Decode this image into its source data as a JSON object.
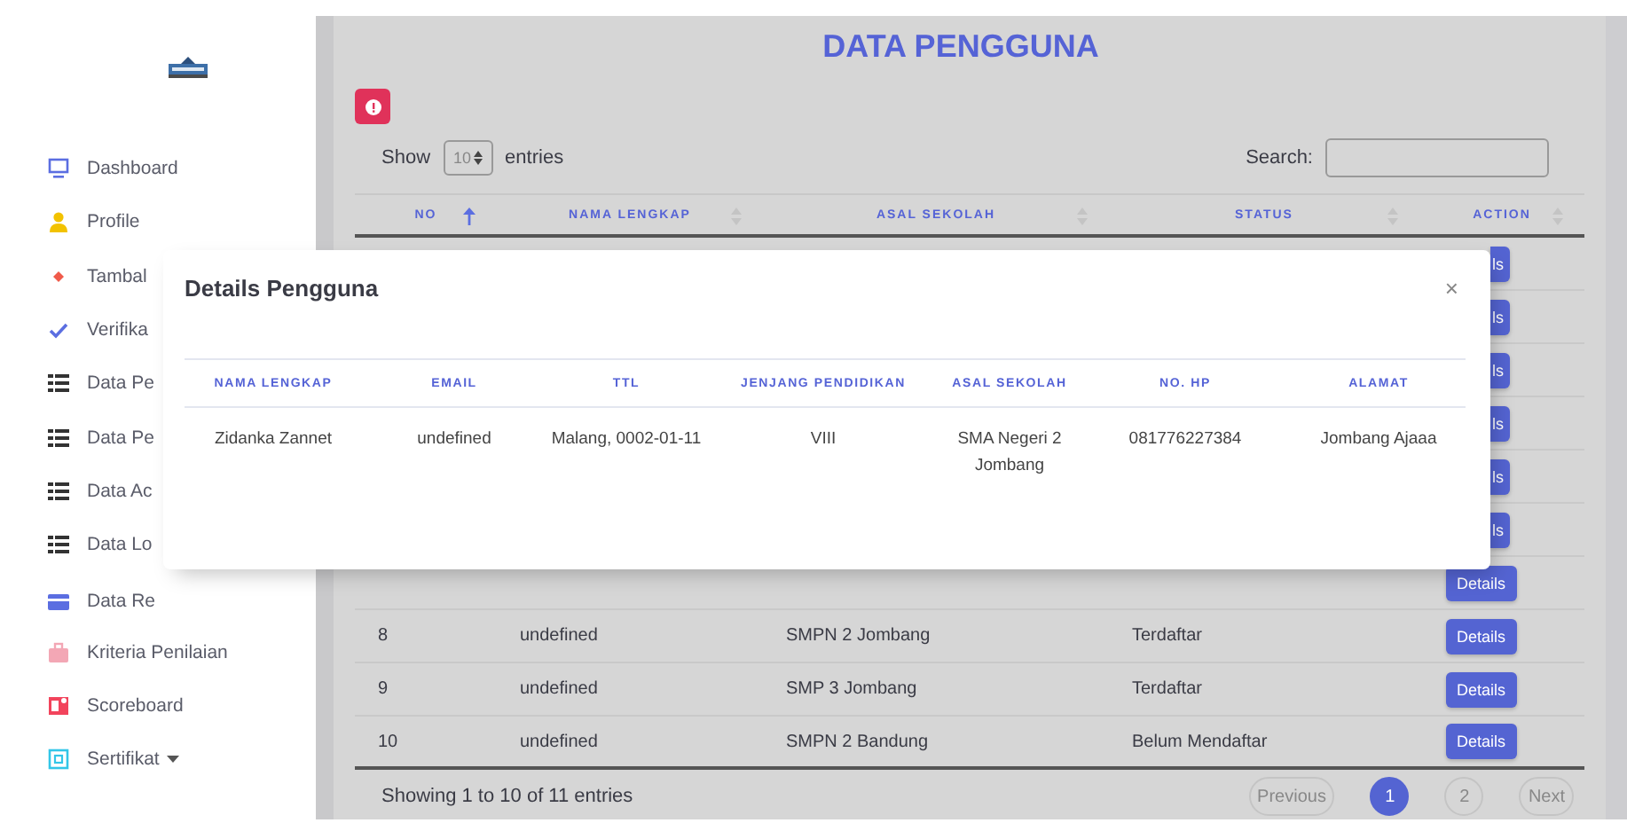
{
  "sidebar": {
    "items": [
      {
        "label": "Dashboard"
      },
      {
        "label": "Profile"
      },
      {
        "label": "Tambal"
      },
      {
        "label": "Verifika"
      },
      {
        "label": "Data Pe"
      },
      {
        "label": "Data Pe"
      },
      {
        "label": "Data Ac"
      },
      {
        "label": "Data Lo"
      },
      {
        "label": "Data Re"
      },
      {
        "label": "Kriteria Penilaian"
      },
      {
        "label": "Scoreboard"
      },
      {
        "label": "Sertifikat",
        "dropdown": true
      }
    ]
  },
  "page": {
    "title": "DATA PENGGUNA",
    "length": {
      "before": "Show",
      "value": "10",
      "after": "entries"
    },
    "search": {
      "label": "Search:"
    },
    "table": {
      "columns": [
        {
          "label": "NO",
          "sorted": true
        },
        {
          "label": "NAMA LENGKAP",
          "sorted": false
        },
        {
          "label": "ASAL SEKOLAH",
          "sorted": false
        },
        {
          "label": "STATUS",
          "sorted": false
        },
        {
          "label": "ACTION",
          "sorted": false
        }
      ],
      "rows": [
        {
          "kind": "stub",
          "action": "ls"
        },
        {
          "kind": "stub",
          "action": "ls"
        },
        {
          "kind": "stub",
          "action": "ls"
        },
        {
          "kind": "stub",
          "action": "ls"
        },
        {
          "kind": "stub",
          "action": "ls"
        },
        {
          "kind": "stub",
          "action": "ls"
        },
        {
          "kind": "button_only",
          "action": "Details"
        },
        {
          "kind": "row",
          "no": "8",
          "nama": "undefined",
          "asal": "SMPN 2 Jombang",
          "status": "Terdaftar",
          "action": "Details"
        },
        {
          "kind": "row",
          "no": "9",
          "nama": "undefined",
          "asal": "SMP 3 Jombang",
          "status": "Terdaftar",
          "action": "Details"
        },
        {
          "kind": "row",
          "no": "10",
          "nama": "undefined",
          "asal": "SMPN 2 Bandung",
          "status": "Belum Mendaftar",
          "action": "Details"
        }
      ]
    },
    "info": "Showing 1 to 10 of 11 entries",
    "pagination": [
      {
        "label": "Previous",
        "selected": false
      },
      {
        "label": "1",
        "selected": true
      },
      {
        "label": "2",
        "selected": false
      },
      {
        "label": "Next",
        "selected": false
      }
    ]
  },
  "modal": {
    "title": "Details Pengguna",
    "close": "×",
    "columns": [
      "NAMA LENGKAP",
      "EMAIL",
      "TTL",
      "JENJANG PENDIDIKAN",
      "ASAL SEKOLAH",
      "NO. HP",
      "ALAMAT"
    ],
    "rows": [
      [
        "Zidanka Zannet",
        "undefined",
        "Malang, 0002-01-11",
        "VIII",
        "SMA Negeri 2 Jombang",
        "081776227384",
        "Jombang Ajaaa"
      ]
    ]
  }
}
